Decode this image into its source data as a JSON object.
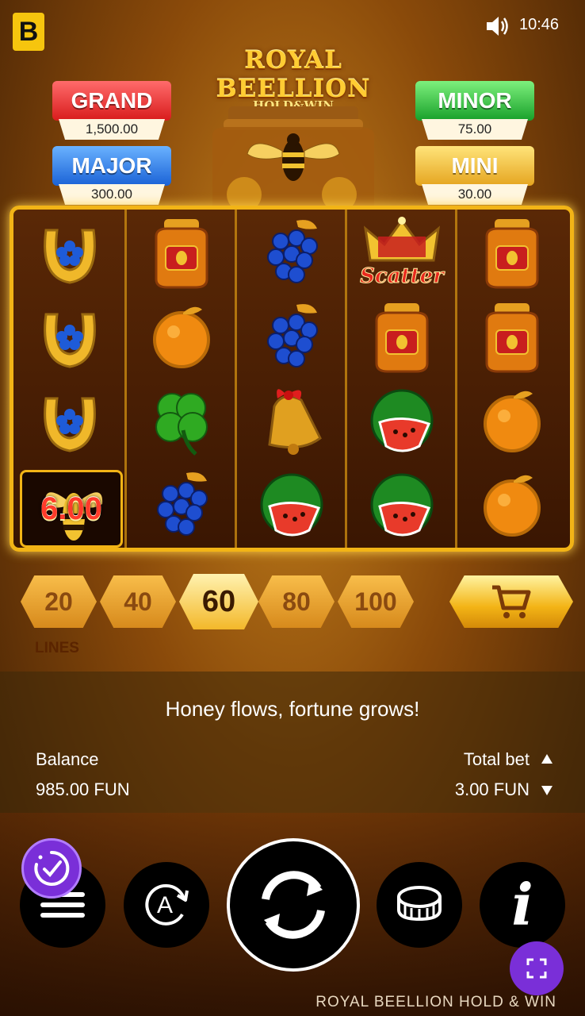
{
  "status_bar": {
    "brand_letter": "B",
    "time": "10:46",
    "sound_icon": "speaker-icon"
  },
  "logo": {
    "line1": "ROYAL BEELLION",
    "line2": "HOLD&WIN"
  },
  "jackpots": {
    "grand": {
      "label": "GRAND",
      "value": "1,500.00",
      "color": "#d81c1c"
    },
    "major": {
      "label": "MAJOR",
      "value": "300.00",
      "color": "#1a62d6"
    },
    "minor": {
      "label": "MINOR",
      "value": "75.00",
      "color": "#18a02a"
    },
    "mini": {
      "label": "MINI",
      "value": "30.00",
      "color": "#e5a520"
    }
  },
  "reels": [
    [
      "horseshoe",
      "horseshoe",
      "horseshoe",
      "bee-bonus"
    ],
    [
      "honey-jar",
      "orange",
      "clover",
      "grapes"
    ],
    [
      "grapes",
      "grapes",
      "bell",
      "watermelon"
    ],
    [
      "crown-scatter",
      "honey-jar",
      "watermelon",
      "watermelon"
    ],
    [
      "honey-jar",
      "honey-jar",
      "orange",
      "orange"
    ]
  ],
  "scatter_label": "Scatter",
  "bonus_value": "6.00",
  "lines": {
    "options": [
      "20",
      "40",
      "60",
      "80",
      "100"
    ],
    "selected": "60",
    "label": "LINES"
  },
  "tagline": "Honey flows, fortune grows!",
  "balance": {
    "label": "Balance",
    "value": "985.00 FUN"
  },
  "total_bet": {
    "label": "Total bet",
    "value": "3.00 FUN"
  },
  "auto_letter": "A",
  "info_letter": "i",
  "footer_title": "ROYAL BEELLION HOLD & WIN",
  "colors": {
    "accent_purple": "#7a2fd8",
    "gold": "#f2b416"
  }
}
